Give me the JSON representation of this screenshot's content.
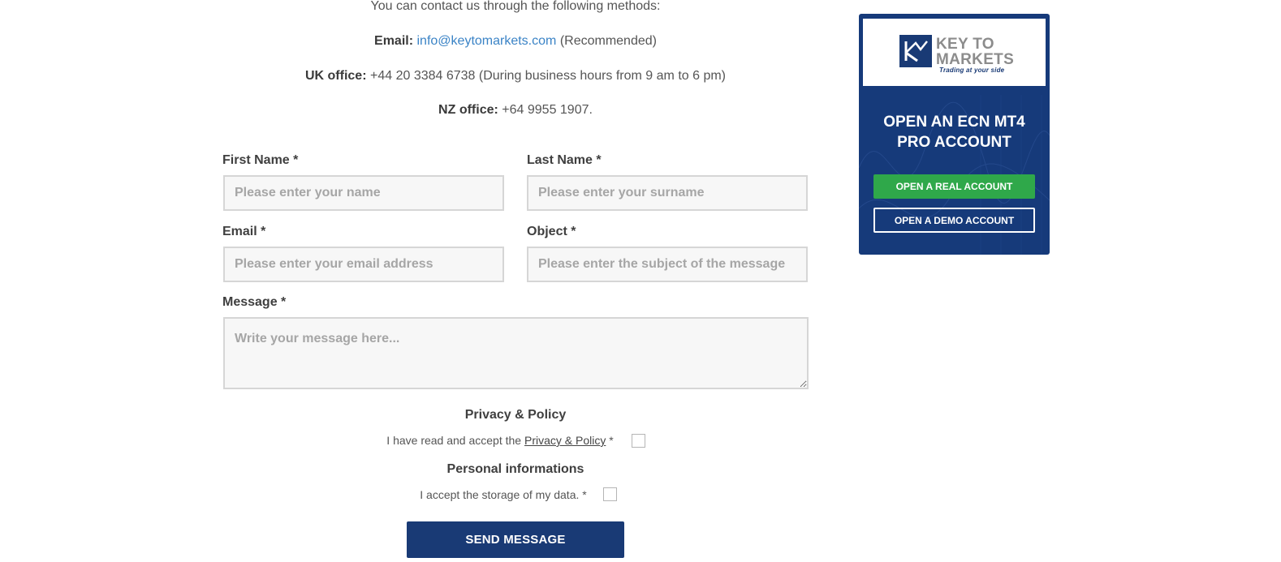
{
  "contact": {
    "intro": "You can contact us through the following methods:",
    "email_label": "Email:",
    "email_value": "info@keytomarkets.com",
    "email_note": "(Recommended)",
    "uk_label": "UK office:",
    "uk_value": "+44 20 3384 6738 (During business hours from 9 am to 6 pm)",
    "nz_label": "NZ office:",
    "nz_value": "+64 9955 1907."
  },
  "form": {
    "first_name": {
      "label": "First Name *",
      "placeholder": "Please enter your name"
    },
    "last_name": {
      "label": "Last Name *",
      "placeholder": "Please enter your surname"
    },
    "email": {
      "label": "Email *",
      "placeholder": "Please enter your email address"
    },
    "object": {
      "label": "Object *",
      "placeholder": "Please enter the subject of the message"
    },
    "message": {
      "label": "Message *",
      "placeholder": "Write your message here..."
    },
    "privacy": {
      "title": "Privacy & Policy",
      "text_before": "I have read and accept the ",
      "link": "Privacy & Policy",
      "text_after": " *"
    },
    "personal": {
      "title": "Personal informations",
      "text": "I accept the storage of my data. *"
    },
    "submit_label": "SEND MESSAGE"
  },
  "banner": {
    "logo_line1": "KEY TO",
    "logo_line2": "MARKETS",
    "logo_tagline": "Trading at your side",
    "title_line1": "OPEN AN ECN MT4",
    "title_line2": "PRO ACCOUNT",
    "real_label": "OPEN A REAL ACCOUNT",
    "demo_label": "OPEN A DEMO ACCOUNT"
  },
  "colors": {
    "brand_navy": "#193a75",
    "banner_bg": "#163a7a",
    "cta_green": "#2fa84a",
    "link_blue": "#3a83c6"
  }
}
